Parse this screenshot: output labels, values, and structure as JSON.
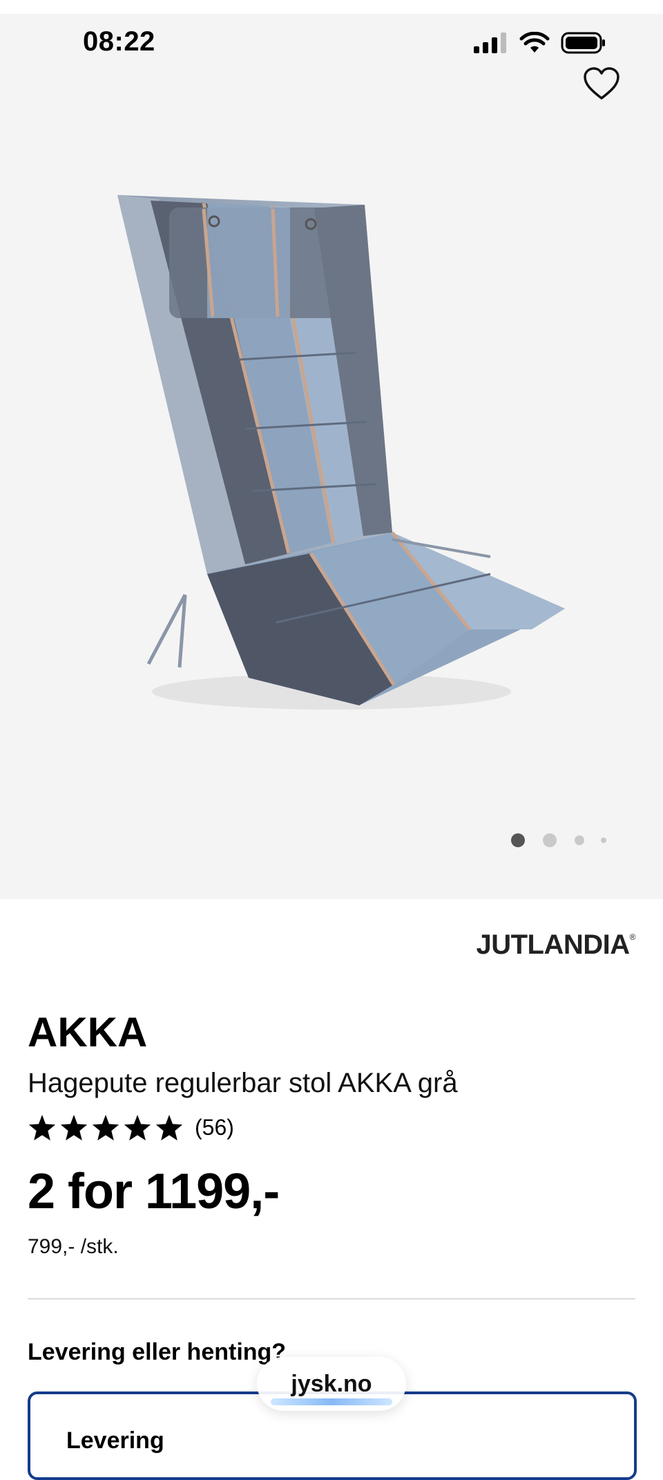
{
  "status_bar": {
    "time": "08:22"
  },
  "gallery": {
    "dot_count": 4,
    "active_index": 0
  },
  "brand": {
    "logo_text": "JUTLANDIA",
    "registered_mark": "®"
  },
  "product": {
    "name": "AKKA",
    "description": "Hagepute regulerbar stol AKKA grå",
    "rating": 5,
    "review_count": "(56)",
    "price_offer": "2 for 1199,-",
    "unit_price": "799,- /stk."
  },
  "delivery": {
    "heading": "Levering eller henting?",
    "option_label": "Levering"
  },
  "browser": {
    "url": "jysk.no"
  },
  "colors": {
    "hero_bg": "#f4f4f4",
    "card_border": "#143c8c",
    "active_dot": "#555555",
    "inactive_dot": "#c9c9c9"
  }
}
